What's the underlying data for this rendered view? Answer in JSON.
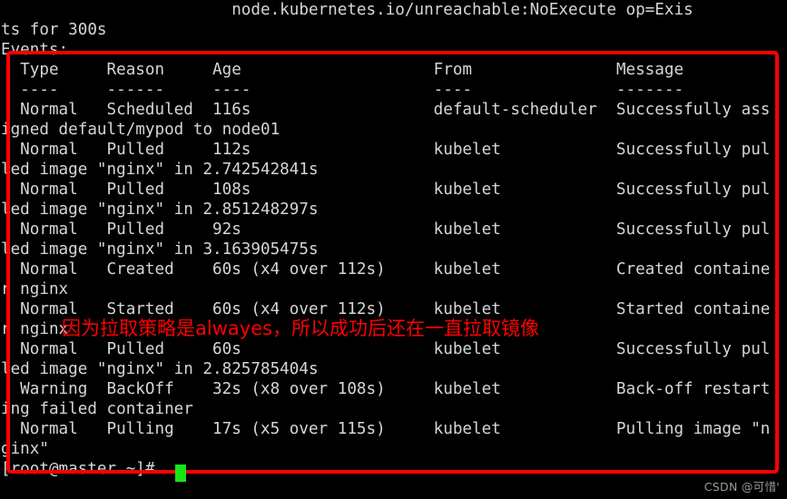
{
  "terminal": {
    "background_color": "#000000",
    "foreground_color": "#d6d6d6",
    "cursor_color": "#19e619",
    "lines": [
      "                        node.kubernetes.io/unreachable:NoExecute op=Exis",
      "ts for 300s",
      "Events:",
      "  Type     Reason     Age                    From               Message",
      "  ----     ------     ----                   ----               -------",
      "  Normal   Scheduled  116s                   default-scheduler  Successfully ass",
      "igned default/mypod to node01",
      "  Normal   Pulled     112s                   kubelet            Successfully pul",
      "led image \"nginx\" in 2.742542841s",
      "  Normal   Pulled     108s                   kubelet            Successfully pul",
      "led image \"nginx\" in 2.851248297s",
      "  Normal   Pulled     92s                    kubelet            Successfully pul",
      "led image \"nginx\" in 3.163905475s",
      "  Normal   Created    60s (x4 over 112s)     kubelet            Created containe",
      "r nginx",
      "  Normal   Started    60s (x4 over 112s)     kubelet            Started containe",
      "r nginx",
      "  Normal   Pulled     60s                    kubelet            Successfully pul",
      "led image \"nginx\" in 2.825785404s",
      "  Warning  BackOff    32s (x8 over 108s)     kubelet            Back-off restart",
      "ing failed container",
      "  Normal   Pulling    17s (x5 over 115s)     kubelet            Pulling image \"n",
      "ginx\"",
      "[root@master ~]# "
    ]
  },
  "annotation": {
    "text": "因为拉取策略是alwayes，所以成功后还在一直拉取镜像",
    "color": "#ff0000"
  },
  "highlight_box": {
    "color": "#ff0000",
    "label": "events-highlight-rectangle"
  },
  "watermark": {
    "text": "CSDN @可惜'",
    "color": "#9a9a9a"
  }
}
